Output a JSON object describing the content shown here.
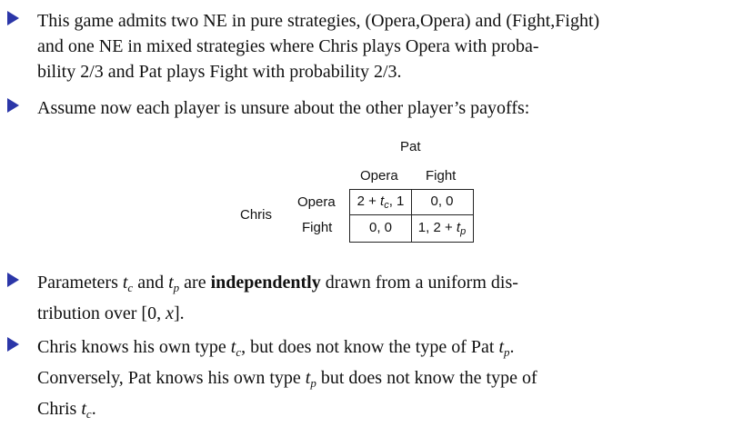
{
  "bullets": [
    {
      "lines": [
        "This game admits two NE in pure strategies, (Opera,Opera) and (Fight,Fight)",
        "and one NE in mixed strategies where Chris plays Opera with proba-",
        "bility 2/3 and Pat plays Fight with probability 2/3."
      ]
    },
    {
      "lines": [
        "Assume now each player is unsure about the other player’s payoffs:"
      ]
    },
    {
      "p1": "Parameters ",
      "tc": "t",
      "tc_sub": "c",
      "and": " and ",
      "tp": "t",
      "tp_sub": "p",
      "p2": " are ",
      "bold": "independently",
      "p3": " drawn from a uniform dis-",
      "line2": "tribution over [0, ",
      "x": "x",
      "line2_end": "]."
    },
    {
      "a1": "Chris knows his own type ",
      "a_t": "t",
      "a_sub": "c",
      "a2": ", but does not know the type of Pat ",
      "a_t2": "t",
      "a_sub2": "p",
      "a3": ".",
      "b1": "Conversely, Pat knows his own type ",
      "b_t": "t",
      "b_sub": "p",
      "b2": " but does not know the type of",
      "c1": "Chris ",
      "c_t": "t",
      "c_sub": "c",
      "c2": "."
    }
  ],
  "game_table": {
    "column_player": "Pat",
    "row_player": "Chris",
    "columns": [
      "Opera",
      "Fight"
    ],
    "rows": [
      "Opera",
      "Fight"
    ],
    "cells": [
      [
        "2 + tc, 1",
        "0, 0"
      ],
      [
        "0, 0",
        "1, 2 + tp"
      ]
    ]
  },
  "accent_color": "#2b36a8"
}
